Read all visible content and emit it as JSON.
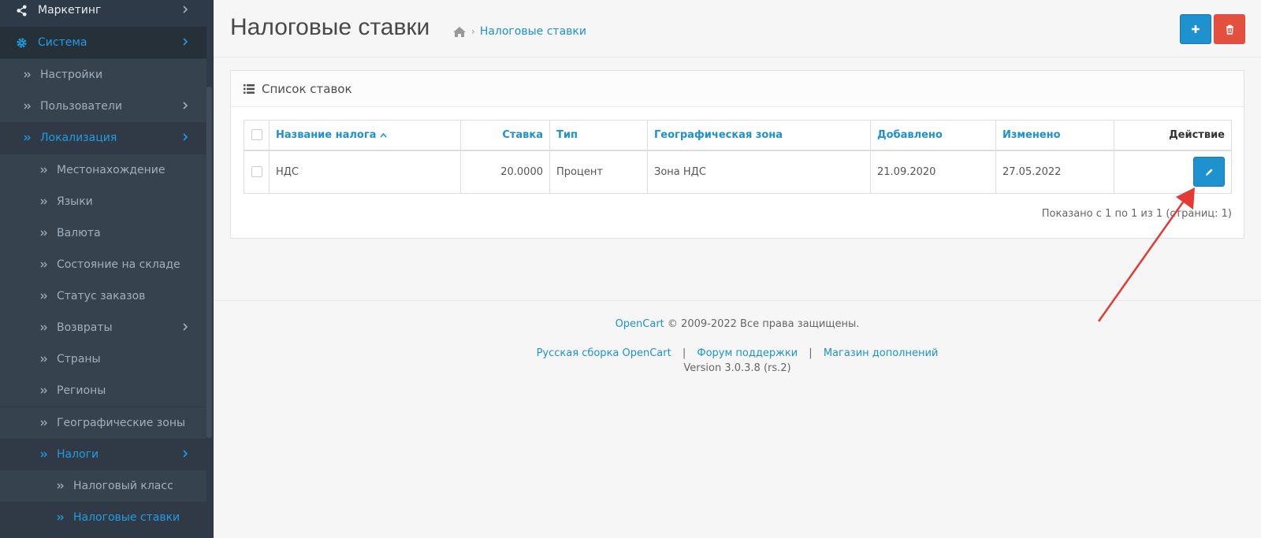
{
  "sidebar": {
    "items": [
      {
        "label": "Маркетинг",
        "icon": "share-icon"
      },
      {
        "label": "Система",
        "icon": "gear-icon"
      },
      {
        "label": "Настройки"
      },
      {
        "label": "Пользователи"
      },
      {
        "label": "Локализация"
      },
      {
        "label": "Местонахождение"
      },
      {
        "label": "Языки"
      },
      {
        "label": "Валюта"
      },
      {
        "label": "Состояние на складе"
      },
      {
        "label": "Статус заказов"
      },
      {
        "label": "Возвраты"
      },
      {
        "label": "Страны"
      },
      {
        "label": "Регионы"
      },
      {
        "label": "Географические зоны"
      },
      {
        "label": "Налоги"
      },
      {
        "label": "Налоговый класс"
      },
      {
        "label": "Налоговые ставки"
      }
    ]
  },
  "header": {
    "title": "Налоговые ставки",
    "breadcrumb": "Налоговые ставки"
  },
  "panel": {
    "title": "Список ставок",
    "columns": [
      "Название налога",
      "Ставка",
      "Тип",
      "Географическая зона",
      "Добавлено",
      "Изменено",
      "Действие"
    ],
    "rows": [
      {
        "name": "НДС",
        "rate": "20.0000",
        "type": "Процент",
        "zone": "Зона НДС",
        "added": "21.09.2020",
        "modified": "27.05.2022"
      }
    ],
    "pagination": "Показано с 1 по 1 из 1 (страниц: 1)"
  },
  "footer": {
    "brand": "OpenCart",
    "copyright": "© 2009-2022 Все права защищены.",
    "links": [
      "Русская сборка OpenCart",
      "Форум поддержки",
      "Магазин дополнений"
    ],
    "separator": "|",
    "version": "Version 3.0.3.8 (rs.2)"
  },
  "colors": {
    "accent": "#1e91cf",
    "danger": "#e3503e",
    "sidebar_bg": "#2e3a47",
    "annotation_arrow": "#e53935"
  }
}
